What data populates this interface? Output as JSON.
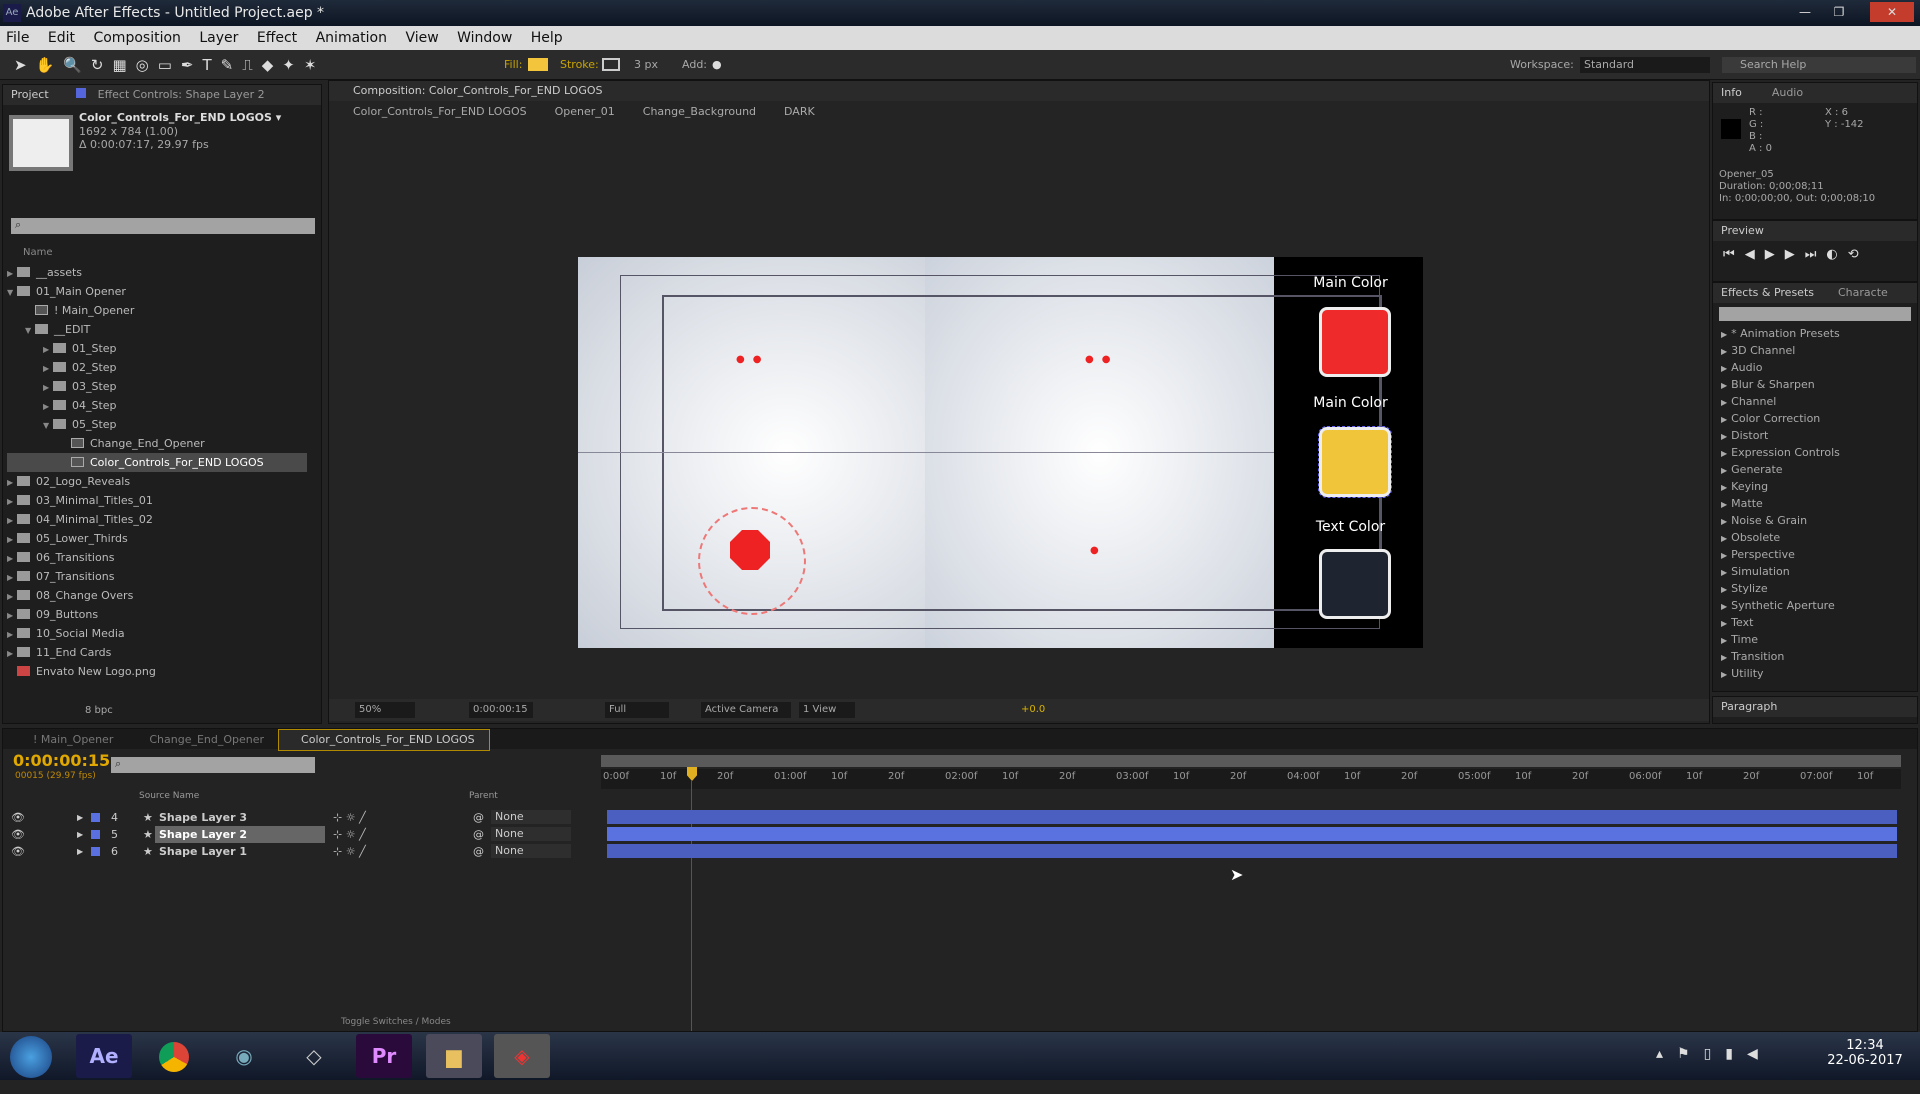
{
  "app": {
    "title": "Adobe After Effects - Untitled Project.aep *",
    "logo": "Ae"
  },
  "menu": [
    "File",
    "Edit",
    "Composition",
    "Layer",
    "Effect",
    "Animation",
    "View",
    "Window",
    "Help"
  ],
  "toolbar": {
    "fill_label": "Fill:",
    "fill_color": "#f2c53d",
    "stroke_label": "Stroke:",
    "stroke_width": "3 px",
    "add_label": "Add:",
    "workspace_label": "Workspace:",
    "workspace_value": "Standard",
    "search_placeholder": "Search Help"
  },
  "project": {
    "tab": "Project",
    "effect_controls_tab": "Effect Controls: Shape Layer 2",
    "comp_name": "Color_Controls_For_END LOGOS ▾",
    "comp_size": "1692 x 784 (1.00)",
    "comp_duration": "Δ 0:00:07:17, 29.97 fps",
    "column_name": "Name",
    "bpc": "8 bpc",
    "items": [
      {
        "label": "__assets",
        "depth": 0,
        "type": "folder",
        "open": false
      },
      {
        "label": "01_Main Opener",
        "depth": 0,
        "type": "folder",
        "open": true
      },
      {
        "label": "! Main_Opener",
        "depth": 1,
        "type": "comp"
      },
      {
        "label": "__EDIT",
        "depth": 1,
        "type": "folder",
        "open": true
      },
      {
        "label": "01_Step",
        "depth": 2,
        "type": "folder",
        "open": false
      },
      {
        "label": "02_Step",
        "depth": 2,
        "type": "folder",
        "open": false
      },
      {
        "label": "03_Step",
        "depth": 2,
        "type": "folder",
        "open": false
      },
      {
        "label": "04_Step",
        "depth": 2,
        "type": "folder",
        "open": false
      },
      {
        "label": "05_Step",
        "depth": 2,
        "type": "folder",
        "open": true
      },
      {
        "label": "Change_End_Opener",
        "depth": 3,
        "type": "comp"
      },
      {
        "label": "Color_Controls_For_END LOGOS",
        "depth": 3,
        "type": "comp",
        "selected": true
      },
      {
        "label": "02_Logo_Reveals",
        "depth": 0,
        "type": "folder",
        "open": false
      },
      {
        "label": "03_Minimal_Titles_01",
        "depth": 0,
        "type": "folder",
        "open": false
      },
      {
        "label": "04_Minimal_Titles_02",
        "depth": 0,
        "type": "folder",
        "open": false
      },
      {
        "label": "05_Lower_Thirds",
        "depth": 0,
        "type": "folder",
        "open": false
      },
      {
        "label": "06_Transitions",
        "depth": 0,
        "type": "folder",
        "open": false
      },
      {
        "label": "07_Transitions",
        "depth": 0,
        "type": "folder",
        "open": false
      },
      {
        "label": "08_Change Overs",
        "depth": 0,
        "type": "folder",
        "open": false
      },
      {
        "label": "09_Buttons",
        "depth": 0,
        "type": "folder",
        "open": false
      },
      {
        "label": "10_Social Media",
        "depth": 0,
        "type": "folder",
        "open": false
      },
      {
        "label": "11_End Cards",
        "depth": 0,
        "type": "folder",
        "open": false
      },
      {
        "label": "Envato New Logo.png",
        "depth": 0,
        "type": "image"
      }
    ]
  },
  "composition": {
    "tab": "Composition: Color_Controls_For_END LOGOS",
    "breadcrumbs": [
      "Color_Controls_For_END LOGOS",
      "Opener_01",
      "Change_Background",
      "DARK"
    ],
    "labels": [
      "Main Color",
      "Main Color",
      "Text Color"
    ],
    "colors": [
      "#ee2a2a",
      "#f0c53a",
      "#1e2430"
    ],
    "zoom": "50%",
    "timecode": "0:00:00:15",
    "resolution": "Full",
    "camera": "Active Camera",
    "views": "1 View",
    "exposure": "+0.0"
  },
  "info": {
    "tab": "Info",
    "audio_tab": "Audio",
    "r": "R :",
    "g": "G :",
    "b": "B :",
    "a": "A : 0",
    "x": "X : 6",
    "y": "Y : -142",
    "layer": "Opener_05",
    "duration": "Duration: 0;00;08;11",
    "inout": "In: 0;00;00;00, Out: 0;00;08;10"
  },
  "preview": {
    "tab": "Preview"
  },
  "effects": {
    "tab": "Effects & Presets",
    "character_tab": "Characte",
    "items": [
      "* Animation Presets",
      "3D Channel",
      "Audio",
      "Blur & Sharpen",
      "Channel",
      "Color Correction",
      "Distort",
      "Expression Controls",
      "Generate",
      "Keying",
      "Matte",
      "Noise & Grain",
      "Obsolete",
      "Perspective",
      "Simulation",
      "Stylize",
      "Synthetic Aperture",
      "Text",
      "Time",
      "Transition",
      "Utility"
    ]
  },
  "paragraph": {
    "tab": "Paragraph"
  },
  "timeline": {
    "tabs": [
      "! Main_Opener",
      "Change_End_Opener",
      "Color_Controls_For_END LOGOS"
    ],
    "timecode": "0:00:00:15",
    "frame_info": "00015 (29.97 fps)",
    "col_source": "Source Name",
    "col_parent": "Parent",
    "toggle_label": "Toggle Switches / Modes",
    "ticks": [
      "0:00f",
      "10f",
      "20f",
      "01:00f",
      "10f",
      "20f",
      "02:00f",
      "10f",
      "20f",
      "03:00f",
      "10f",
      "20f",
      "04:00f",
      "10f",
      "20f",
      "05:00f",
      "10f",
      "20f",
      "06:00f",
      "10f",
      "20f",
      "07:00f",
      "10f"
    ],
    "layers": [
      {
        "num": "4",
        "name": "Shape Layer 3",
        "parent": "None"
      },
      {
        "num": "5",
        "name": "Shape Layer 2",
        "parent": "None",
        "selected": true
      },
      {
        "num": "6",
        "name": "Shape Layer 1",
        "parent": "None"
      }
    ]
  },
  "taskbar": {
    "apps": [
      "Ae",
      "Chrome",
      "Media",
      "App",
      "Pr",
      "Explorer",
      "Tool"
    ],
    "time": "12:34",
    "date": "22-06-2017"
  }
}
